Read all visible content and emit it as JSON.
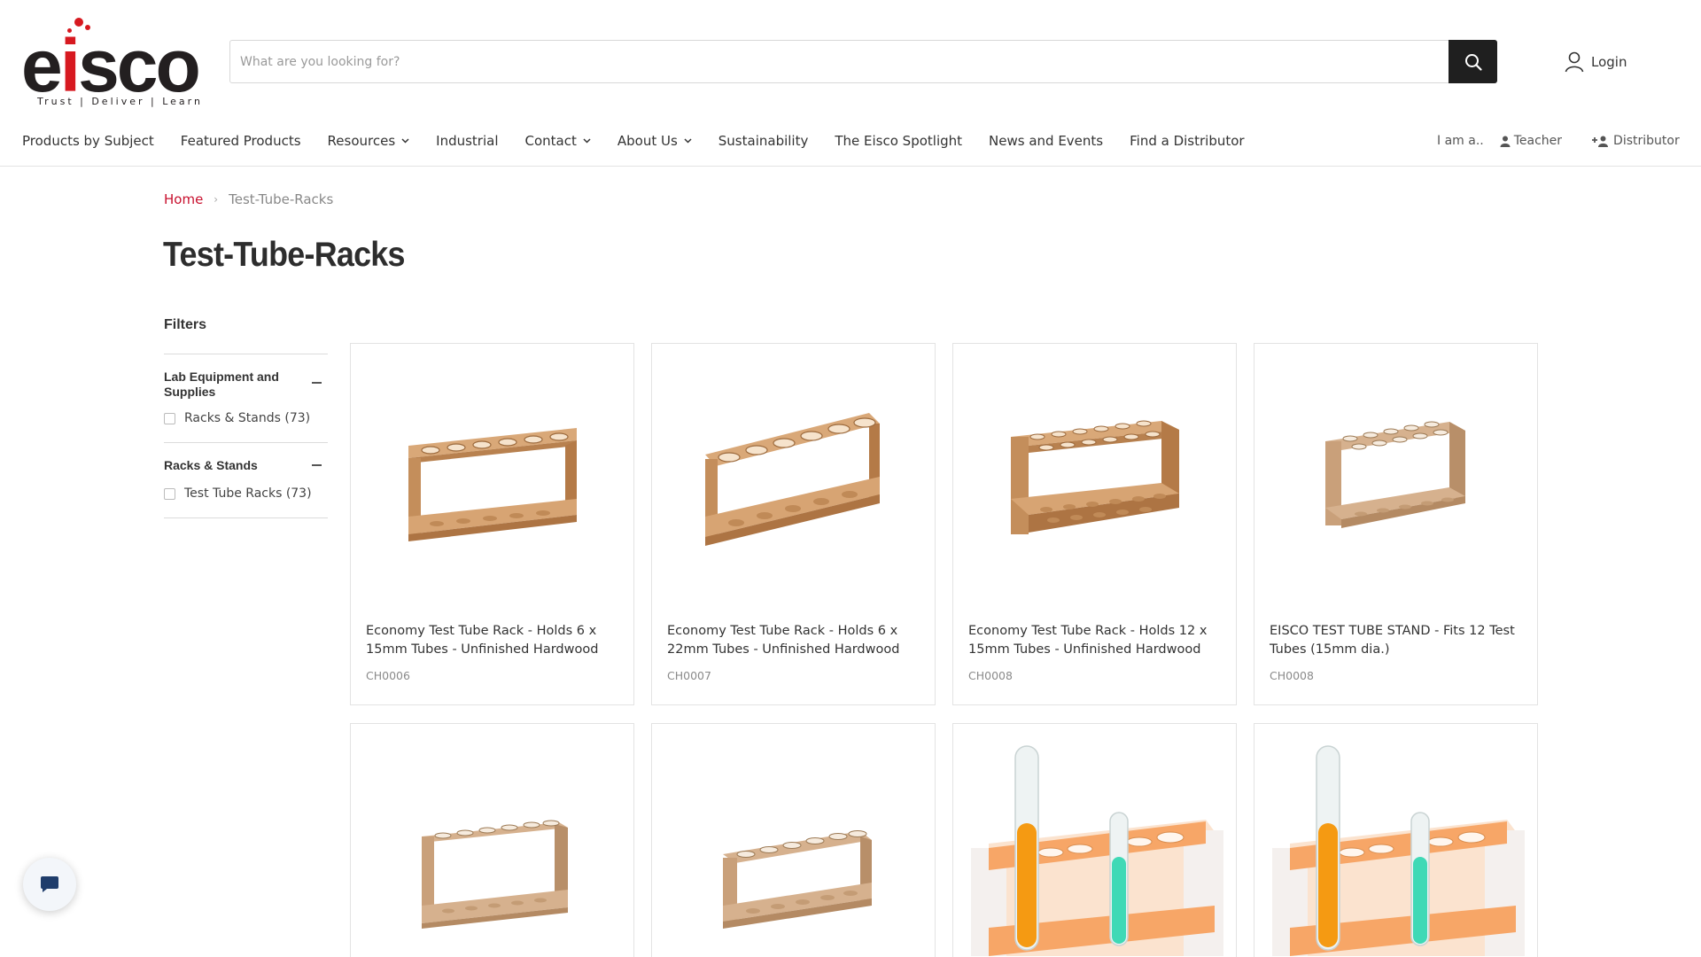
{
  "brand": {
    "logo_text_e": "e",
    "logo_text_i": "i",
    "logo_text_rest": "sco",
    "tagline": "Trust | Deliver | Learn",
    "accent_color": "#c8102e"
  },
  "search": {
    "placeholder": "What are you looking for?",
    "button_icon": "search-icon"
  },
  "account": {
    "login_label": "Login",
    "icon": "user-icon"
  },
  "nav": {
    "items": [
      {
        "label": "Products by Subject",
        "has_dropdown": false
      },
      {
        "label": "Featured Products",
        "has_dropdown": false
      },
      {
        "label": "Resources",
        "has_dropdown": true
      },
      {
        "label": "Industrial",
        "has_dropdown": false
      },
      {
        "label": "Contact",
        "has_dropdown": true
      },
      {
        "label": "About Us",
        "has_dropdown": true
      },
      {
        "label": "Sustainability",
        "has_dropdown": false
      },
      {
        "label": "The Eisco Spotlight",
        "has_dropdown": false
      },
      {
        "label": "News and Events",
        "has_dropdown": false
      },
      {
        "label": "Find a Distributor",
        "has_dropdown": false
      }
    ]
  },
  "role_switch": {
    "label": "I am a..",
    "teacher": "Teacher",
    "distributor": "Distributor"
  },
  "breadcrumb": {
    "home": "Home",
    "separator": "›",
    "current": "Test-Tube-Racks"
  },
  "page_title": "Test-Tube-Racks",
  "filters": {
    "title": "Filters",
    "groups": [
      {
        "title": "Lab Equipment and Supplies",
        "options": [
          {
            "label": "Racks & Stands (73)",
            "checked": false
          }
        ]
      },
      {
        "title": "Racks & Stands",
        "options": [
          {
            "label": "Test Tube Racks (73)",
            "checked": false
          }
        ]
      }
    ]
  },
  "products": [
    {
      "name": "Economy Test Tube Rack - Holds 6 x 15mm Tubes - Unfinished Hardwood",
      "sku": "CH0006"
    },
    {
      "name": "Economy Test Tube Rack - Holds 6 x 22mm Tubes - Unfinished Hardwood",
      "sku": "CH0007"
    },
    {
      "name": "Economy Test Tube Rack - Holds 12 x 15mm Tubes - Unfinished Hardwood",
      "sku": "CH0008"
    },
    {
      "name": "EISCO TEST TUBE STAND - Fits 12 Test Tubes (15mm dia.)",
      "sku": "CH0008"
    },
    {
      "name": "",
      "sku": ""
    },
    {
      "name": "",
      "sku": ""
    },
    {
      "name": "",
      "sku": ""
    },
    {
      "name": "",
      "sku": ""
    }
  ],
  "chat": {
    "icon": "chat-icon"
  }
}
